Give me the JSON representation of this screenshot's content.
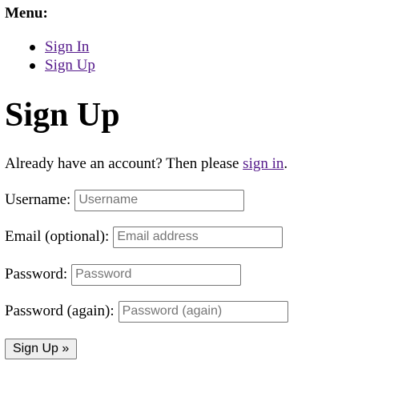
{
  "menu": {
    "heading": "Menu:",
    "items": [
      {
        "label": "Sign In"
      },
      {
        "label": "Sign Up"
      }
    ]
  },
  "page": {
    "title": "Sign Up",
    "intro_prefix": "Already have an account? Then please ",
    "intro_link": "sign in",
    "intro_suffix": "."
  },
  "form": {
    "username": {
      "label": "Username:",
      "placeholder": "Username",
      "value": ""
    },
    "email": {
      "label": "Email (optional):",
      "placeholder": "Email address",
      "value": ""
    },
    "password": {
      "label": "Password:",
      "placeholder": "Password",
      "value": ""
    },
    "password2": {
      "label": "Password (again):",
      "placeholder": "Password (again)",
      "value": ""
    },
    "submit_label": "Sign Up »"
  },
  "colors": {
    "link": "#551a8b",
    "text": "#000000",
    "background": "#ffffff"
  }
}
